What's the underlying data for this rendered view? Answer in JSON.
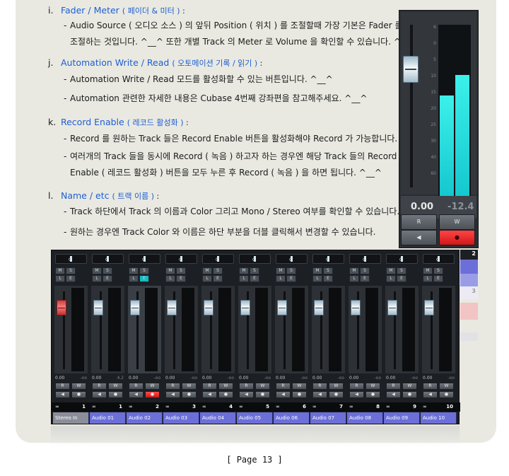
{
  "items": [
    {
      "label": "i.",
      "title": "Fader / Meter",
      "title_ko": "( 페이더 & 미터 )",
      "colon": " :",
      "lines": [
        {
          "text": "Audio Source ( 오디오 소스 ) 의 앞뒤 Position ( 위치 ) 를 조절할때 가장 기본은 Fader 를",
          "cont": false
        },
        {
          "text": "조절하는 것입니다. ^__^ 또한 개별 Track 의 Meter 로 Volume 을 확인할 수 있습니다. ^__^",
          "cont": true
        }
      ]
    },
    {
      "label": "j.",
      "title": "Automation Write / Read",
      "title_ko": "( 오토메이션 기록 / 읽기 )",
      "colon": " :",
      "lines": [
        {
          "text": "Automation Write / Read 모드를 활성화할 수 있는 버튼입니다. ^__^",
          "cont": false
        },
        {
          "text": "Automation 관련한 자세한 내용은 Cubase 4번째 강좌편을 참고해주세요. ^__^",
          "cont": false
        }
      ]
    },
    {
      "label": "k.",
      "title": "Record Enable",
      "title_ko": "( 레코드 활성화 )",
      "colon": " :",
      "lines": [
        {
          "text": "Record 를 원하는 Track 들은 Record Enable 버튼을 활성화해야 Record 가 가능합니다.",
          "cont": false
        },
        {
          "text": "여러개의 Track 들을 동시에 Record ( 녹음 ) 하고자 하는 경우엔 해당 Track 들의 Record",
          "cont": false
        },
        {
          "text": "Enable ( 레코드 활성화 ) 버튼을 모두 누른 후 Record ( 녹음 ) 을 하면 됩니다. ^__^",
          "cont": true
        }
      ]
    },
    {
      "label": "l.",
      "title": "Name / etc",
      "title_ko": "( 트랙 이름 )",
      "colon": " :",
      "lines": [
        {
          "text": "Track 하단에서 Track 의 이름과 Color 그리고 Mono / Stereo 여부를 확인할 수 있습니다.",
          "cont": false
        },
        {
          "text": "원하는 경우엔 Track Color 와 이름은 하단 부분을 더블 클릭해서 변경할 수 있습니다.",
          "cont": false
        }
      ]
    }
  ],
  "strip": {
    "scale": [
      "6",
      "0",
      "5",
      "10",
      "15",
      "20",
      "25",
      "30",
      "40",
      "60"
    ],
    "meter_scale": [
      "0",
      "5",
      "10",
      "20",
      "30",
      "40",
      "50",
      "60"
    ],
    "fader_value": "0.00",
    "meter_value": "-12.4",
    "buttons": {
      "read": "R",
      "write": "W",
      "monitor": "◀",
      "record": "●"
    },
    "meter_levels": [
      0.58,
      0.7
    ],
    "colors": {
      "meter": "#1ecfd4",
      "record": "#ff3030",
      "peak_value": "#7e8790"
    }
  },
  "mixer": {
    "pan_label": "C",
    "mute_label": "M",
    "solo_label": "S",
    "listen_label": "L",
    "edit_label": "E",
    "read_label": "R",
    "write_label": "W",
    "monitor_label": "◀",
    "record_label": "●",
    "link_icon": "∞",
    "channels": [
      {
        "name": "Stereo In",
        "num": "1",
        "v1": "0.00",
        "v2": "-oo",
        "selected": false,
        "red_fader": true,
        "rec": false,
        "stereo": true
      },
      {
        "name": "Audio 01",
        "num": "1",
        "v1": "0.00",
        "v2": "4.2",
        "selected": false,
        "red_fader": false,
        "rec": false,
        "stereo": false
      },
      {
        "name": "Audio 02",
        "num": "2",
        "v1": "0.00",
        "v2": "-oo",
        "selected": true,
        "red_fader": false,
        "rec": true,
        "stereo": false
      },
      {
        "name": "Audio 03",
        "num": "3",
        "v1": "0.00",
        "v2": "-oo",
        "selected": false,
        "red_fader": false,
        "rec": false,
        "stereo": false
      },
      {
        "name": "Audio 04",
        "num": "4",
        "v1": "0.00",
        "v2": "-oo",
        "selected": false,
        "red_fader": false,
        "rec": false,
        "stereo": false
      },
      {
        "name": "Audio 05",
        "num": "5",
        "v1": "0.00",
        "v2": "-oo",
        "selected": false,
        "red_fader": false,
        "rec": false,
        "stereo": false
      },
      {
        "name": "Audio 06",
        "num": "6",
        "v1": "0.00",
        "v2": "-oo",
        "selected": false,
        "red_fader": false,
        "rec": false,
        "stereo": false
      },
      {
        "name": "Audio 07",
        "num": "7",
        "v1": "0.00",
        "v2": "-oo",
        "selected": false,
        "red_fader": false,
        "rec": false,
        "stereo": false
      },
      {
        "name": "Audio 08",
        "num": "8",
        "v1": "0.00",
        "v2": "-oo",
        "selected": false,
        "red_fader": false,
        "rec": false,
        "stereo": false
      },
      {
        "name": "Audio 09",
        "num": "9",
        "v1": "0.00",
        "v2": "-oo",
        "selected": false,
        "red_fader": false,
        "rec": false,
        "stereo": false
      },
      {
        "name": "Audio 10",
        "num": "10",
        "v1": "0.00",
        "v2": "-oo",
        "selected": false,
        "red_fader": false,
        "rec": false,
        "stereo": false
      }
    ],
    "colors": {
      "name_bar": "#6c6fd8",
      "selected_edit": "#19b9c2",
      "record": "#e02020"
    }
  },
  "edge_fragments": {
    "top_number": "2",
    "bottom_number": "3"
  },
  "footer": {
    "page": "[ Page 13 ]"
  }
}
